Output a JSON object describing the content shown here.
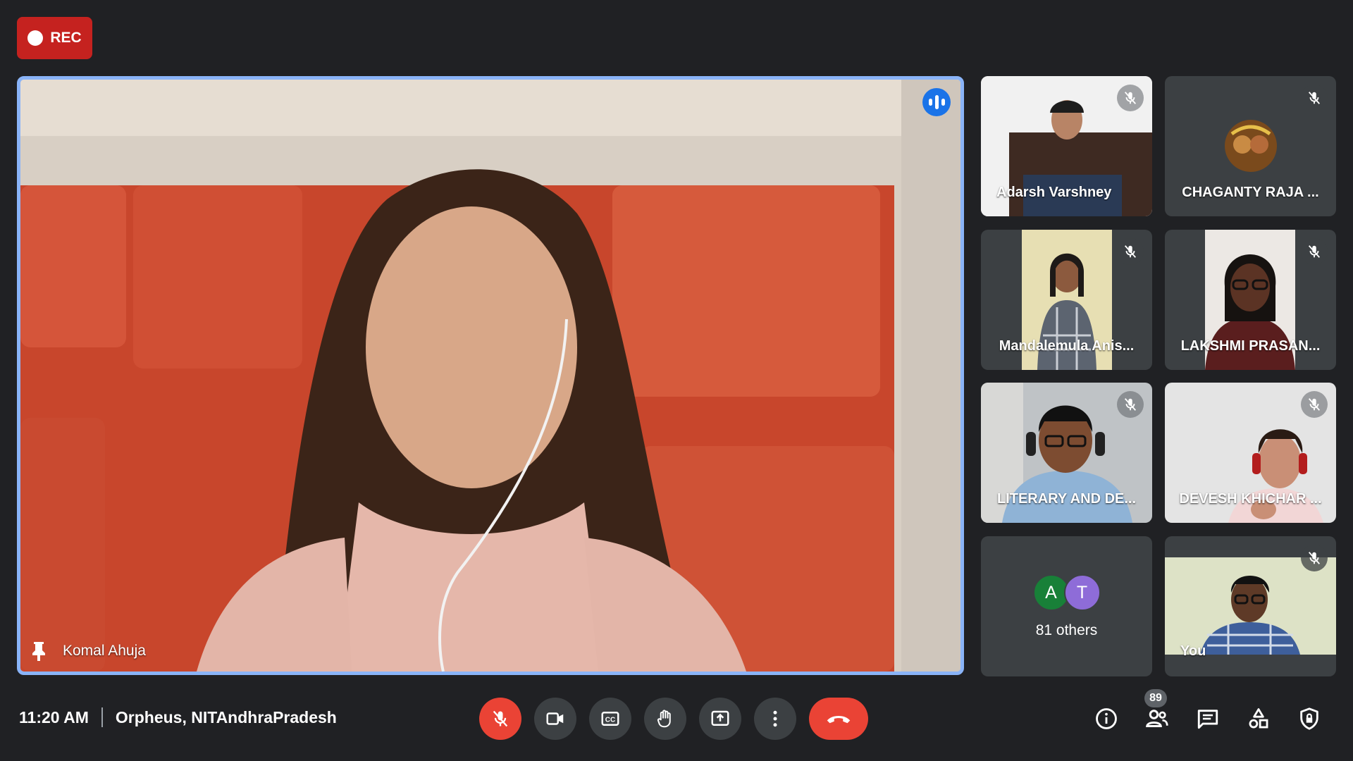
{
  "recording": {
    "label": "REC"
  },
  "main_speaker": {
    "name": "Komal Ahuja"
  },
  "participants": [
    {
      "name": "Adarsh Varshney"
    },
    {
      "name": "CHAGANTY RAJA ..."
    },
    {
      "name": "Mandalemula Anis..."
    },
    {
      "name": "LAKSHMI PRASAN..."
    },
    {
      "name": "LITERARY AND DE..."
    },
    {
      "name": "DEVESH KHICHAR ..."
    },
    {
      "name": "You"
    }
  ],
  "others": {
    "avatars": [
      "A",
      "T"
    ],
    "label": "81 others",
    "colors": [
      "#188038",
      "#8e6cd8"
    ]
  },
  "meeting": {
    "time": "11:20 AM",
    "name": "Orpheus, NITAndhraPradesh"
  },
  "people_count": "89",
  "colors": {
    "accent": "#8ab4f8",
    "danger": "#ea4335",
    "rec": "#c5221f",
    "background": "#202124"
  }
}
